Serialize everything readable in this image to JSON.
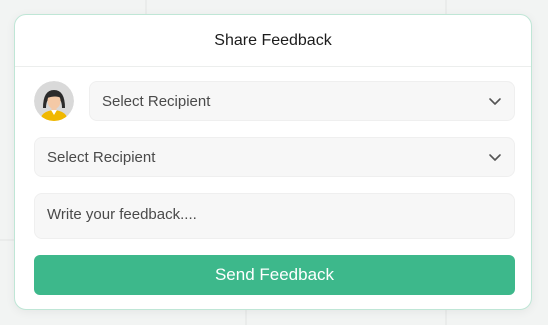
{
  "dialog": {
    "title": "Share Feedback"
  },
  "recipient_primary": {
    "value": "Select Recipient",
    "icon": "chevron-down-icon"
  },
  "recipient_secondary": {
    "value": "Select Recipient",
    "icon": "chevron-down-icon"
  },
  "feedback": {
    "placeholder": "Write your feedback...."
  },
  "actions": {
    "send_label": "Send Feedback"
  },
  "colors": {
    "accent": "#3db88b",
    "card_border": "#bfe6d6",
    "field_bg": "#f7f7f7"
  },
  "avatar": {
    "icon": "user-avatar-icon"
  }
}
